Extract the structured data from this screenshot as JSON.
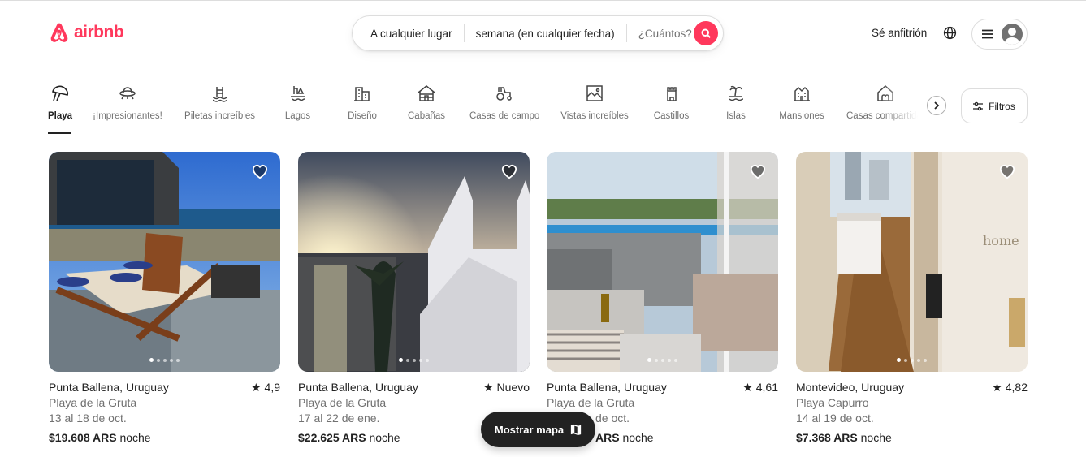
{
  "brand": {
    "name": "airbnb",
    "color": "#ff385c"
  },
  "search": {
    "where": "A cualquier lugar",
    "when": "semana (en cualquier fecha)",
    "who": "¿Cuántos?",
    "button_icon": "search-icon"
  },
  "header": {
    "host_label": "Sé anfitrión",
    "globe_icon": "globe-icon",
    "menu_icon": "hamburger-icon",
    "avatar_icon": "user-avatar-icon"
  },
  "categories": [
    {
      "label": "Playa",
      "icon": "beach-umbrella-icon",
      "active": true
    },
    {
      "label": "¡Impresionantes!",
      "icon": "ufo-icon",
      "active": false
    },
    {
      "label": "Piletas increíbles",
      "icon": "pool-icon",
      "active": false
    },
    {
      "label": "Lagos",
      "icon": "lake-icon",
      "active": false
    },
    {
      "label": "Diseño",
      "icon": "building-icon",
      "active": false
    },
    {
      "label": "Cabañas",
      "icon": "cabin-icon",
      "active": false
    },
    {
      "label": "Casas de campo",
      "icon": "tractor-icon",
      "active": false
    },
    {
      "label": "Vistas increíbles",
      "icon": "landscape-icon",
      "active": false
    },
    {
      "label": "Castillos",
      "icon": "castle-icon",
      "active": false
    },
    {
      "label": "Islas",
      "icon": "island-icon",
      "active": false
    },
    {
      "label": "Mansiones",
      "icon": "mansion-icon",
      "active": false
    },
    {
      "label": "Casas compartidas",
      "icon": "shared-home-icon",
      "active": false
    }
  ],
  "filters": {
    "label": "Filtros",
    "icon": "sliders-icon"
  },
  "listings": [
    {
      "location": "Punta Ballena, Uruguay",
      "rating": "4,9",
      "area": "Playa de la Gruta",
      "dates": "13 al 18 de oct.",
      "price": "$19.608 ARS",
      "unit": "noche"
    },
    {
      "location": "Punta Ballena, Uruguay",
      "rating": "Nuevo",
      "area": "Playa de la Gruta",
      "dates": "17 al 22 de ene.",
      "price": "$22.625 ARS",
      "unit": "noche"
    },
    {
      "location": "Punta Ballena, Uruguay",
      "rating": "4,61",
      "area": "Playa de la Gruta",
      "dates": "de oct.",
      "price": "ARS",
      "unit": "noche"
    },
    {
      "location": "Montevideo, Uruguay",
      "rating": "4,82",
      "area": "Playa Capurro",
      "dates": "14 al 19 de oct.",
      "price": "$7.368 ARS",
      "unit": "noche"
    }
  ],
  "map_button": {
    "label": "Mostrar mapa",
    "icon": "map-icon"
  }
}
